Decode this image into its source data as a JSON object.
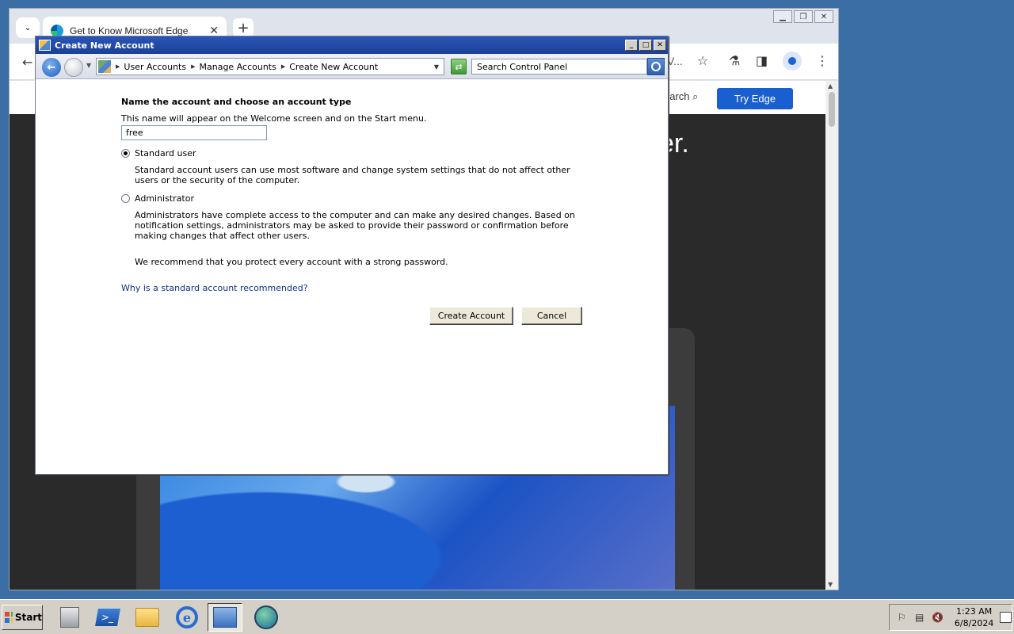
{
  "browser": {
    "tab_title": "Get to Know Microsoft Edge",
    "tab_close": "✕",
    "new_tab": "+",
    "omnibox_tail": "V...",
    "page": {
      "search_label": "earch",
      "cta_button": "Try Edge",
      "hero_fragment": "er."
    }
  },
  "dialog": {
    "title": "Create New Account",
    "breadcrumbs": [
      "User Accounts",
      "Manage Accounts",
      "Create New Account"
    ],
    "search_placeholder": "Search Control Panel",
    "heading": "Name the account and choose an account type",
    "subtext": "This name will appear on the Welcome screen and on the Start menu.",
    "account_name": "free",
    "options": [
      {
        "label": "Standard user",
        "selected": true,
        "description": "Standard account users can use most software and change system settings that do not affect other users or the security of the computer."
      },
      {
        "label": "Administrator",
        "selected": false,
        "description": "Administrators have complete access to the computer and can make any desired changes. Based on notification settings, administrators may be asked to provide their password or confirmation before making changes that affect other users."
      }
    ],
    "recommendation": "We recommend that you protect every account with a strong password.",
    "help_link": "Why is a standard account recommended?",
    "buttons": {
      "create": "Create Account",
      "cancel": "Cancel"
    }
  },
  "taskbar": {
    "start_label": "Start",
    "clock_time": "1:23 AM",
    "clock_date": "6/8/2024"
  },
  "colors": {
    "desktop": "#3a6ea5",
    "titlebar": "#1b3f96",
    "link": "#10308c",
    "edge_cta": "#1a5fcf"
  }
}
